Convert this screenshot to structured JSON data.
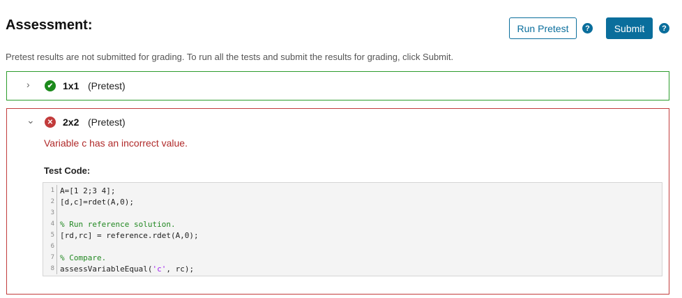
{
  "header": {
    "title": "Assessment:",
    "run_pretest_label": "Run Pretest",
    "submit_label": "Submit",
    "help_glyph": "?"
  },
  "note": "Pretest results are not submitted for grading. To run all the tests and submit the results for grading, click Submit.",
  "tests": [
    {
      "name": "1x1",
      "tag": "(Pretest)",
      "status": "pass",
      "expanded": false,
      "chevron": "›",
      "status_glyph": "✔"
    },
    {
      "name": "2x2",
      "tag": "(Pretest)",
      "status": "fail",
      "expanded": true,
      "chevron": "⌄",
      "status_glyph": "✕",
      "error": "Variable c has an incorrect value.",
      "test_code_label": "Test Code:",
      "code_lines": [
        {
          "n": "1",
          "text": "A=[1 2;3 4];"
        },
        {
          "n": "2",
          "text": "[d,c]=rdet(A,0);"
        },
        {
          "n": "3",
          "text": ""
        },
        {
          "n": "4",
          "text": "% Run reference solution."
        },
        {
          "n": "5",
          "text": "[rd,rc] = reference.rdet(A,0);"
        },
        {
          "n": "6",
          "text": ""
        },
        {
          "n": "7",
          "text": "% Compare."
        },
        {
          "n": "8",
          "text_before": "assessVariableEqual(",
          "text_string": "'c'",
          "text_after": ", rc);"
        }
      ]
    }
  ],
  "colors": {
    "accent": "#0a6e9c",
    "pass": "#1c8a1c",
    "fail": "#c23b3b",
    "comment": "#228822",
    "string": "#a020f0"
  }
}
